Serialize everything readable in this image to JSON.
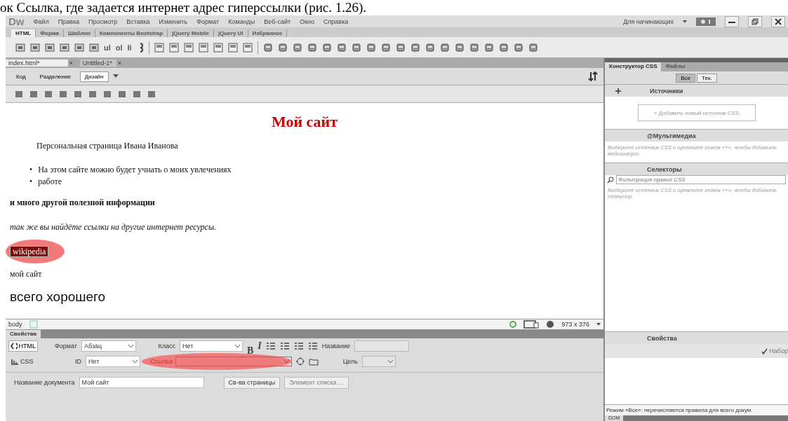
{
  "caption": "ок Ссылка, где задается интернет адрес гиперссылки (рис. 1.26).",
  "menubar": {
    "logo": "Dw",
    "items": [
      "Файл",
      "Правка",
      "Просмотр",
      "Вставка",
      "Изменить",
      "Формат",
      "Команды",
      "Веб-сайт",
      "Окно",
      "Справка"
    ],
    "workspace": "Для начинающих"
  },
  "insert_tabs": [
    {
      "label": "HTML",
      "selected": true
    },
    {
      "label": "Форма",
      "selected": false
    },
    {
      "label": "Шаблон",
      "selected": false
    },
    {
      "label": "Компоненты Bootstrap",
      "selected": false
    },
    {
      "label": "jQuery Mobile",
      "selected": false
    },
    {
      "label": "jQuery UI",
      "selected": false
    },
    {
      "label": "Избранное",
      "selected": false
    }
  ],
  "insert_toolbar": {
    "text_buttons": [
      "ul",
      "ol",
      "li"
    ]
  },
  "doc_tabs": [
    {
      "label": "index.html*",
      "selected": true,
      "close": "×"
    },
    {
      "label": "Untitled-1*",
      "selected": false,
      "close": "×"
    }
  ],
  "views": [
    {
      "label": "Код",
      "selected": false
    },
    {
      "label": "Разделение",
      "selected": false
    },
    {
      "label": "Дизайн",
      "selected": true
    }
  ],
  "design": {
    "heading": "Мой сайт",
    "paragraph": "Персональная страница Ивана Иванова",
    "list": [
      {
        "bullet": "•",
        "text": "На этом сайте можно будет учнать о моих увлечениях"
      },
      {
        "bullet": "•",
        "text": "работе"
      }
    ],
    "bold_line": "и много другой полезной информации",
    "italic_line": "так же вы найдёте ссылки на другие интернет ресурсы.",
    "link": {
      "text": "wikipedia",
      "selected": true,
      "annotated": true
    },
    "plain_line": "мой сайт",
    "large_line": "всего хорошего"
  },
  "status_bar": {
    "tag": "body",
    "size": "973 x 376"
  },
  "properties": {
    "title": "Свойства",
    "html_label": "HTML",
    "css_label": "CSS",
    "format": {
      "label": "Формат",
      "value": "Абзац"
    },
    "class": {
      "label": "Класс",
      "value": "Нет"
    },
    "id": {
      "label": "ID",
      "value": "Нет"
    },
    "bold": "B",
    "italic": "I",
    "name_label": "Название",
    "link": {
      "label": "Ссылка",
      "annotated": true
    },
    "target_label": "Цель",
    "doc_title": {
      "label": "Название документа",
      "value": "Мой сайт"
    },
    "page_props": {
      "label": "Св-ва страницы",
      "disabled": false
    },
    "list_item": {
      "label": "Элемент списка ...",
      "disabled": true
    }
  },
  "panel": {
    "tabs": [
      {
        "label": "Конструктор CSS",
        "selected": true
      },
      {
        "label": "Файлы",
        "selected": false
      }
    ],
    "filter_buttons": [
      {
        "label": "Все",
        "selected": true
      },
      {
        "label": "Тек.",
        "selected": false
      }
    ],
    "sources": {
      "title": "Источники",
      "add": "+ Добавить новый источник CSS"
    },
    "media": {
      "title": "@Мультимедиа",
      "hint": "Выберите источник CSS и щелкните значок «+», чтобы добавить медиазапрос."
    },
    "selectors": {
      "title": "Селекторы",
      "placeholder": "Фильтрация правил CSS",
      "hint": "Выберите источник CSS и щелкните значок «+», чтобы добавить селектор."
    },
    "properties": {
      "title": "Свойства",
      "checkbox": {
        "label": "Набор",
        "checked": true
      }
    },
    "footer": "Режим «Все»: перечисляются правила для всего докум.",
    "dom_tab": "DOM"
  }
}
